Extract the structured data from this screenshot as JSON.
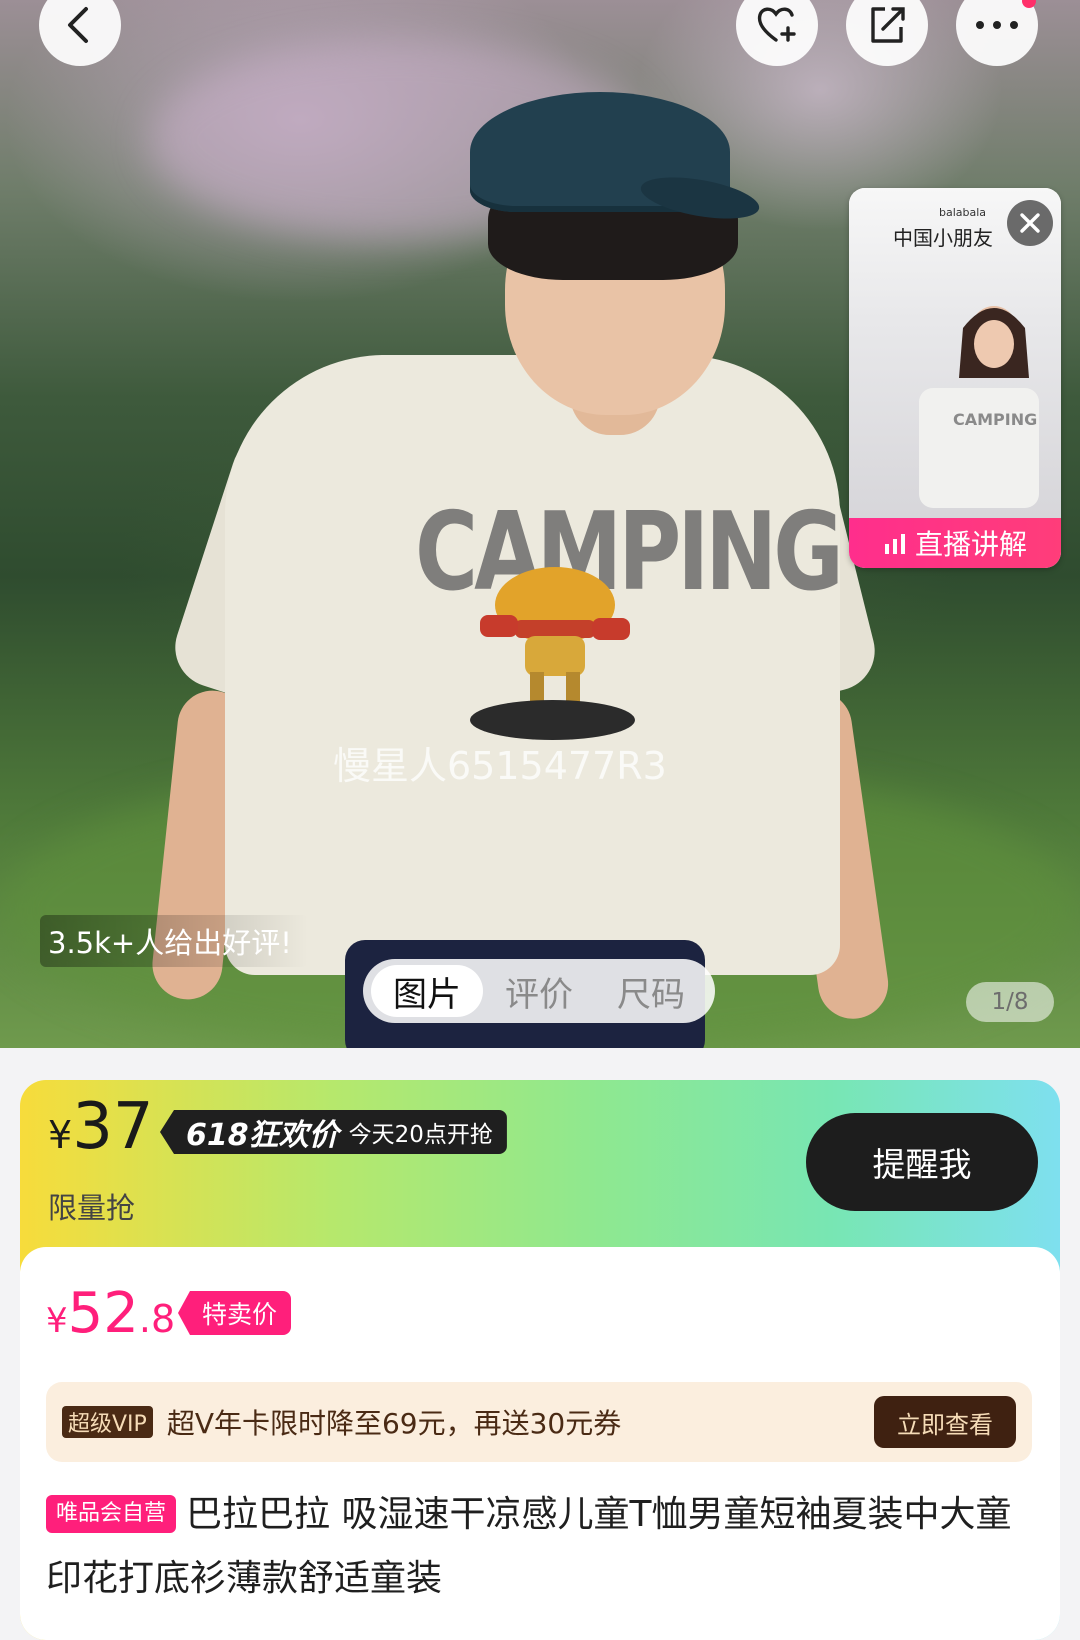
{
  "hero": {
    "shirt_print": "CAMPING",
    "watermark": "慢星人6515477R3",
    "rating_note": "3.5k+人给出好评!",
    "tabs": [
      "图片",
      "评价",
      "尺码"
    ],
    "active_tab": 0,
    "page_counter": "1/8"
  },
  "top_bar": {
    "back_icon": "chevron-left-icon",
    "favorite_icon": "heart-plus-icon",
    "share_icon": "share-icon",
    "more_icon": "more-dots-icon"
  },
  "live_card": {
    "brand": "balabala",
    "title": "中国小朋友",
    "shirt_text": "CAMPING",
    "label": "直播讲解",
    "close_icon": "close-icon",
    "live_icon": "live-bars-icon"
  },
  "flash_sale": {
    "currency": "¥",
    "price": "37",
    "event_tag": "618狂欢价",
    "event_time": "今天20点开抢",
    "limited_label": "限量抢",
    "remind_button": "提醒我"
  },
  "sale_price": {
    "currency": "¥",
    "integer": "52",
    "decimal": ".8",
    "tag": "特卖价"
  },
  "vip": {
    "badge": "超级VIP",
    "text": "超V年卡限时降至69元，再送30元券",
    "button": "立即查看"
  },
  "product": {
    "self_operated_tag": "唯品会自营",
    "title": "巴拉巴拉 吸湿速干凉感儿童T恤男童短袖夏装中大童印花打底衫薄款舒适童装"
  },
  "colors": {
    "accent_pink": "#ff1f7b",
    "dark": "#1d1d1d",
    "vip_brown": "#4a2a14"
  }
}
